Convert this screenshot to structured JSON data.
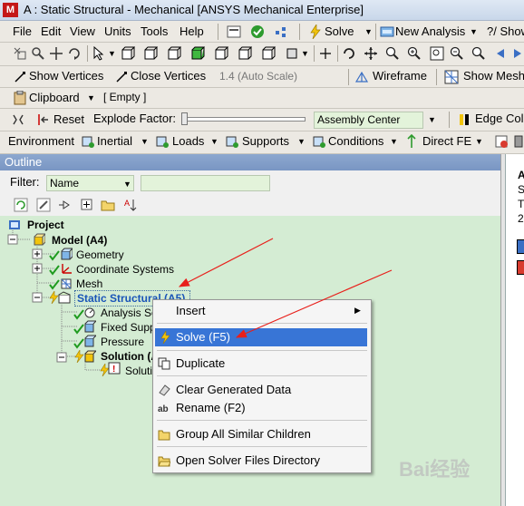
{
  "window": {
    "title": "A : Static Structural - Mechanical [ANSYS Mechanical Enterprise]",
    "app_icon": "M"
  },
  "menubar": [
    "File",
    "Edit",
    "View",
    "Units",
    "Tools",
    "Help"
  ],
  "toolbar_main": {
    "solve_label": "Solve",
    "new_analysis_label": "New Analysis",
    "help_label": "?/ Show"
  },
  "toolbar_graphics": {
    "show_vertices": "Show Vertices",
    "close_vertices": "Close Vertices",
    "auto_scale": "1.4 (Auto Scale)",
    "wireframe": "Wireframe",
    "show_mesh": "Show Mesh"
  },
  "toolbar_clipboard": {
    "clipboard_label": "Clipboard",
    "empty_label": "[ Empty ]"
  },
  "toolbar_explode": {
    "reset_label": "Reset",
    "explode_factor_label": "Explode Factor:",
    "assembly_center": "Assembly Center",
    "edge_coloring": "Edge Colo"
  },
  "context_toolbar": {
    "environment": "Environment",
    "inertial": "Inertial",
    "loads": "Loads",
    "supports": "Supports",
    "conditions": "Conditions",
    "direct_fe": "Direct FE"
  },
  "outline": {
    "title": "Outline",
    "filter_label": "Filter:",
    "filter_value": "Name"
  },
  "tree": {
    "project": "Project",
    "model": "Model (A4)",
    "geometry": "Geometry",
    "coordinate_systems": "Coordinate Systems",
    "mesh": "Mesh",
    "static_structural": "Static Structural (A5)",
    "analysis_settings": "Analysis Set",
    "fixed_support": "Fixed Suppo",
    "pressure": "Pressure",
    "solution": "Solution (A",
    "solution_info": "Solutio"
  },
  "context_menu": {
    "insert": "Insert",
    "solve": "Solve (F5)",
    "duplicate": "Duplicate",
    "clear_generated_data": "Clear Generated Data",
    "rename": "Rename (F2)",
    "group_all_similar_children": "Group All Similar Children",
    "open_solver_files_directory": "Open Solver Files Directory"
  },
  "right_panel_letters": [
    "A",
    "S",
    "T",
    "2"
  ],
  "watermark": "Bai经验",
  "colors": {
    "tree_bg": "#d4ecd3",
    "menu_highlight": "#3875d6",
    "title_bg": "#c9d7ea",
    "arrow": "#e8201b"
  }
}
